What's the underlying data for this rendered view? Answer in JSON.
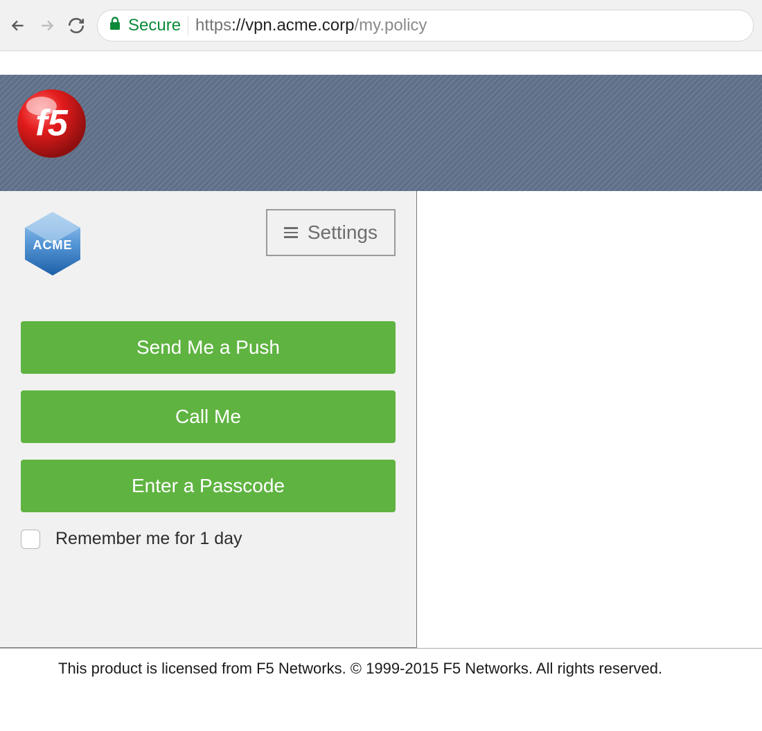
{
  "browser": {
    "secure_label": "Secure",
    "url_scheme": "https",
    "url_host": "://vpn.acme.corp",
    "url_path": "/my.policy"
  },
  "banner": {
    "logo_text": "f5"
  },
  "prompt": {
    "org_logo_text": "ACME",
    "settings_label": "Settings",
    "buttons": {
      "push": "Send Me a Push",
      "call": "Call Me",
      "passcode": "Enter a Passcode"
    },
    "remember_label": "Remember me for 1 day"
  },
  "footer": {
    "text": "This product is licensed from F5 Networks. © 1999-2015 F5 Networks. All rights reserved."
  },
  "colors": {
    "accent_green": "#5fb341",
    "secure_green": "#0a8a3a",
    "banner_bg": "#6a7a92"
  }
}
